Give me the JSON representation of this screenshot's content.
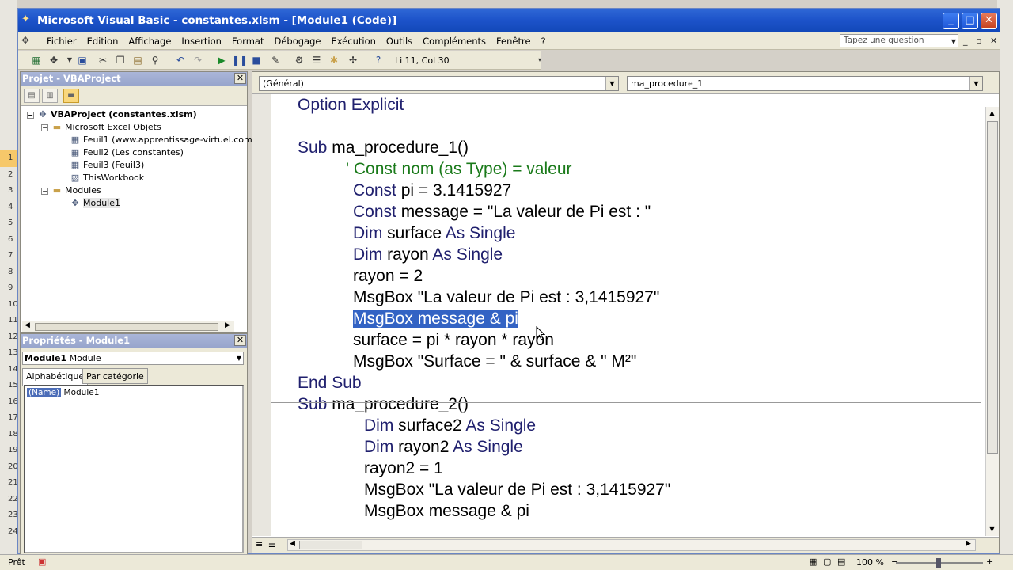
{
  "window": {
    "title": "Microsoft Visual Basic - constantes.xlsm - [Module1 (Code)]",
    "controls": [
      "_",
      "□",
      "✕"
    ]
  },
  "menu": {
    "items": [
      "Fichier",
      "Edition",
      "Affichage",
      "Insertion",
      "Format",
      "Débogage",
      "Exécution",
      "Outils",
      "Compléments",
      "Fenêtre",
      "?"
    ],
    "help_placeholder": "Tapez une question",
    "mini_controls": [
      "_",
      "▫",
      "✕"
    ]
  },
  "toolbar": {
    "position": "Li 11, Col 30"
  },
  "project": {
    "title": "Projet - VBAProject",
    "root": "VBAProject (constantes.xlsm)",
    "excel_objects_folder": "Microsoft Excel Objets",
    "sheets": [
      "Feuil1 (www.apprentissage-virtuel.com)",
      "Feuil2 (Les constantes)",
      "Feuil3 (Feuil3)",
      "ThisWorkbook"
    ],
    "modules_folder": "Modules",
    "module": "Module1"
  },
  "properties": {
    "title": "Propriétés - Module1",
    "object_name": "Module1",
    "object_type": "Module",
    "tab_alpha": "Alphabétique",
    "tab_category": "Par catégorie",
    "row_key": "(Name)",
    "row_value": "Module1"
  },
  "code": {
    "combo_object": "(Général)",
    "combo_proc": "ma_procedure_1",
    "lines": {
      "l1": "Option Explicit",
      "l3_kw": "Sub",
      "l3_rest": " ma_procedure_1()",
      "l4": "' Const nom (as Type) = valeur",
      "l5_kw": "Const",
      "l5_rest": " pi = 3.1415927",
      "l6_kw": "Const",
      "l6_rest": " message = \"La valeur de Pi est : \"",
      "l7_kw": "Dim",
      "l7_mid": " surface ",
      "l7_kw2": "As Single",
      "l8_kw": "Dim",
      "l8_mid": " rayon ",
      "l8_kw2": "As Single",
      "l9": "rayon = 2",
      "l10": "MsgBox \"La valeur de Pi est : 3,1415927\"",
      "l11_sel": "MsgBox message & pi",
      "l12": "surface = pi * rayon * rayon",
      "l13": "MsgBox \"Surface = \" & surface & \" M²\"",
      "l14": "End Sub",
      "l15_kw": "Sub",
      "l15_rest": " ma_procedure_2()",
      "l16_kw": "Dim",
      "l16_mid": " surface2 ",
      "l16_kw2": "As Single",
      "l17_kw": "Dim",
      "l17_mid": " rayon2 ",
      "l17_kw2": "As Single",
      "l18": "rayon2 = 1",
      "l19": "MsgBox \"La valeur de Pi est : 3,1415927\"",
      "l20": "MsgBox message & pi"
    }
  },
  "status": {
    "text": "Prêt",
    "zoom": "100 %"
  },
  "excel_rows": [
    "1",
    "2",
    "3",
    "4",
    "5",
    "6",
    "7",
    "8",
    "9",
    "10",
    "11",
    "12",
    "13",
    "14",
    "15",
    "16",
    "17",
    "18",
    "19",
    "20",
    "21",
    "22",
    "23",
    "24"
  ],
  "colors": {
    "title_bar": "#1c52c9",
    "keyword": "#20206e",
    "comment": "#1a7a1a",
    "selection": "#3363c4"
  }
}
